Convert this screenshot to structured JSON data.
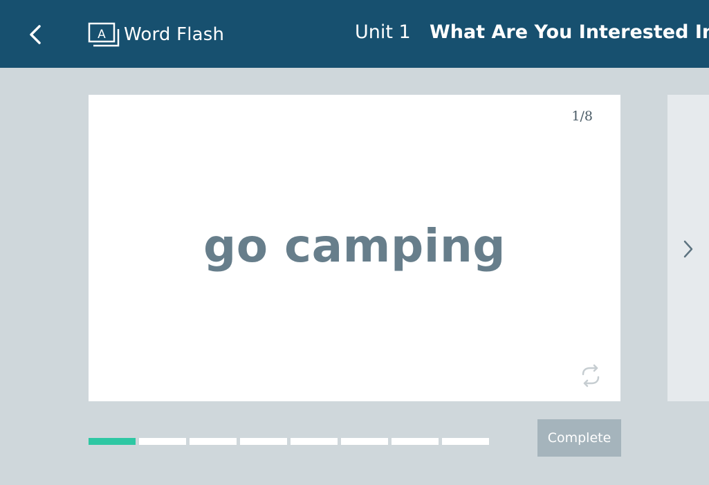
{
  "header": {
    "back_icon": "chevron-left-icon",
    "app_icon": "word-flash-icon",
    "app_title": "Word Flash",
    "unit": "Unit 1",
    "lesson_title": "What Are You Interested In?",
    "background_color": "#17506f"
  },
  "card": {
    "counter": "1/8",
    "word": "go camping",
    "flip_icon": "flip-arrows-icon"
  },
  "navigation": {
    "next_icon": "chevron-right-icon"
  },
  "progress": {
    "total": 8,
    "completed": 1,
    "done_color": "#2ec7a3",
    "pending_color": "#ffffff"
  },
  "footer": {
    "complete_label": "Complete"
  }
}
